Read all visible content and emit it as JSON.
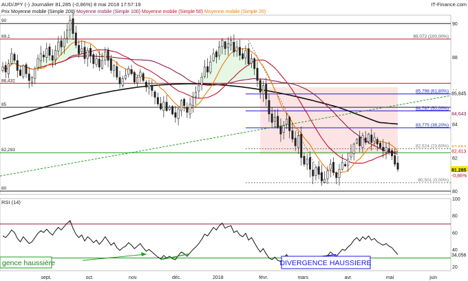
{
  "header": {
    "symbol": "AUD/JPY (-)",
    "period": "Journalier",
    "last": "81,285 (-0,86%)",
    "datetime": "8 mai 2018 17:57:19",
    "brand": "IT-Finance.com",
    "legend": [
      {
        "label": "Prix",
        "color": "#222222"
      },
      {
        "label": "Moyenne mobile (Simple 200)",
        "color": "#111111"
      },
      {
        "label": "Moyenne mobile (Simple 100)",
        "color": "#8b1a4a"
      },
      {
        "label": "Moyenne mobile (Simple 50)",
        "color": "#c0102a"
      },
      {
        "label": "Moyenne mobile (Simple 20)",
        "color": "#f07c00"
      }
    ]
  },
  "chart_data": [
    {
      "type": "candlestick",
      "ylim": [
        79.8,
        90.5
      ],
      "y_axis_ticks": [
        80,
        82,
        84,
        86,
        88,
        90
      ],
      "x_axis_ticks": [
        "sept.",
        "oct.",
        "nov.",
        "déc.",
        "2018",
        "févr.",
        "mars",
        "avr.",
        "mai",
        "juin"
      ],
      "horizontal_levels": [
        {
          "value": 90,
          "left_label": "90",
          "color": "#222222"
        },
        {
          "value": 89.072,
          "right_label": "89,072 (100,00%)",
          "left_label": "89,1",
          "color": "#c0102a"
        },
        {
          "value": 86.43,
          "left_label": "86,432",
          "color": "#c0102a"
        },
        {
          "value": 85,
          "left_label": "85",
          "color": "#222222"
        },
        {
          "value": 82.293,
          "left_label": "82,293",
          "color": "#1e9e1e"
        },
        {
          "value": 80,
          "left_label": "80",
          "color": "#222222"
        }
      ],
      "fibonacci_levels": [
        {
          "value": 85.798,
          "label": "85,798 (61,80%)",
          "color": "#1a1adc"
        },
        {
          "value": 84.787,
          "label": "84,787 (50,00%)",
          "color": "#1a1adc"
        },
        {
          "value": 83.775,
          "label": "83,775 (38,20%)",
          "color": "#1a1adc"
        },
        {
          "value": 82.524,
          "label": "82,524 (23,60%)",
          "color": "#777777"
        },
        {
          "value": 80.501,
          "label": "80,501 (0,00%)",
          "color": "#777777"
        }
      ],
      "right_labels": [
        {
          "value": 85.845,
          "text": "85,845",
          "bg": "#ffffff",
          "fg": "#111111"
        },
        {
          "value": 84.643,
          "text": "84,643",
          "bg": "#ffffff",
          "fg": "#8b1a4a"
        },
        {
          "value": 82.653,
          "text": "82,653",
          "bg": "#ffffff",
          "fg": "#f07c00"
        },
        {
          "value": 82.413,
          "text": "82,413",
          "bg": "#ffffff",
          "fg": "#c0102a"
        },
        {
          "value": 81.285,
          "text": "81,285",
          "bg": "#f5e600",
          "fg": "#111111"
        },
        {
          "value": 80.95,
          "text": "-0,86%",
          "bg": "#ffffff",
          "fg": "#c0102a"
        }
      ],
      "closes": [
        87.4,
        87.1,
        87.6,
        88.2,
        87.8,
        87.2,
        86.9,
        87.5,
        87.0,
        86.6,
        86.8,
        87.3,
        87.9,
        88.2,
        88.0,
        88.5,
        88.1,
        87.8,
        88.4,
        88.9,
        88.6,
        89.1,
        89.6,
        90.2,
        89.4,
        88.7,
        88.2,
        88.5,
        87.9,
        88.4,
        88.1,
        87.6,
        87.9,
        87.4,
        87.8,
        88.3,
        87.8,
        87.2,
        87.5,
        86.8,
        86.4,
        86.7,
        86.9,
        87.3,
        87.0,
        86.5,
        86.8,
        87.1,
        86.6,
        86.2,
        86.4,
        86.0,
        85.6,
        85.2,
        84.9,
        85.3,
        84.8,
        85.0,
        84.6,
        84.4,
        84.9,
        85.4,
        85.1,
        84.7,
        85.2,
        85.6,
        85.9,
        86.3,
        86.8,
        87.4,
        87.1,
        87.7,
        88.2,
        88.0,
        88.6,
        89.0,
        88.5,
        88.8,
        89.0,
        88.3,
        88.6,
        88.1,
        87.9,
        88.4,
        87.6,
        87.9,
        87.3,
        86.6,
        85.9,
        86.3,
        85.5,
        84.6,
        84.1,
        84.4,
        83.8,
        83.4,
        83.9,
        84.3,
        83.6,
        83.1,
        82.7,
        83.3,
        82.0,
        81.6,
        81.9,
        81.3,
        80.9,
        81.4,
        81.0,
        80.6,
        80.7,
        81.2,
        81.6,
        81.1,
        80.8,
        81.3,
        81.7,
        81.5,
        81.9,
        82.3,
        82.8,
        83.1,
        82.7,
        83.3,
        82.9,
        83.4,
        82.9,
        83.2,
        82.8,
        82.6,
        82.4,
        82.6,
        82.3,
        82.1,
        81.6,
        81.3
      ]
    },
    {
      "type": "line",
      "title": "RSI (14)",
      "ylim": [
        15,
        100
      ],
      "y_axis_ticks": [
        20,
        40,
        60,
        80,
        100
      ],
      "overbought": 70,
      "oversold": 30,
      "current": "34,056",
      "values": [
        56,
        54,
        58,
        63,
        60,
        53,
        49,
        55,
        51,
        47,
        49,
        54,
        59,
        62,
        60,
        64,
        60,
        57,
        62,
        66,
        63,
        67,
        71,
        74,
        65,
        58,
        54,
        57,
        50,
        55,
        52,
        48,
        51,
        46,
        50,
        55,
        50,
        45,
        48,
        42,
        39,
        42,
        44,
        48,
        45,
        41,
        44,
        47,
        42,
        38,
        40,
        37,
        34,
        31,
        29,
        33,
        30,
        32,
        29,
        28,
        33,
        37,
        35,
        32,
        36,
        40,
        43,
        47,
        52,
        58,
        56,
        61,
        66,
        63,
        68,
        71,
        65,
        67,
        68,
        60,
        62,
        57,
        55,
        59,
        51,
        54,
        48,
        42,
        37,
        41,
        35,
        30,
        28,
        31,
        27,
        26,
        30,
        34,
        29,
        26,
        25,
        30,
        27,
        26,
        29,
        27,
        26,
        30,
        28,
        27,
        28,
        33,
        37,
        34,
        32,
        36,
        40,
        39,
        43,
        46,
        51,
        54,
        50,
        55,
        52,
        56,
        51,
        53,
        49,
        47,
        45,
        47,
        44,
        42,
        38,
        34
      ]
    }
  ],
  "annotations": {
    "left_divergence": "gence haussière",
    "right_divergence": "DIVERGENCE HAUSSIERE"
  },
  "rsi_labels": [
    "100",
    "80",
    "60",
    "40",
    "34,056",
    "20"
  ]
}
